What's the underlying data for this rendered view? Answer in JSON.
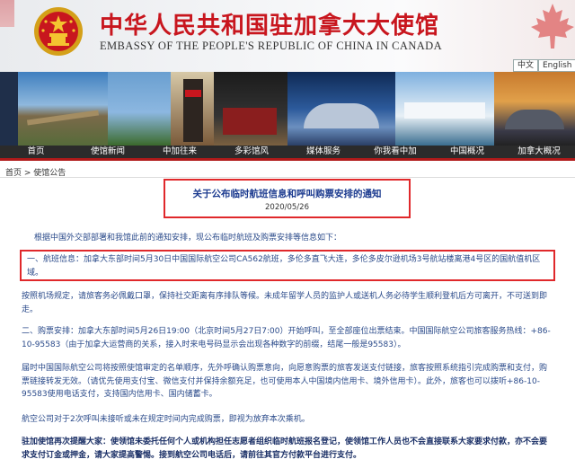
{
  "header": {
    "title_cn": "中华人民共和国驻加拿大大使馆",
    "title_en": "EMBASSY OF THE PEOPLE'S REPUBLIC OF CHINA IN CANADA",
    "lang_cn": "中文",
    "lang_en": "English"
  },
  "nav": {
    "items": [
      "首页",
      "使馆新闻",
      "中加往来",
      "多彩馆风",
      "媒体服务",
      "你我看中加",
      "中国概况",
      "加拿大概况"
    ]
  },
  "breadcrumb": "首页 > 使馆公告",
  "article": {
    "title": "关于公布临时航班信息和呼叫购票安排的通知",
    "date": "2020/05/26",
    "intro": "根据中国外交部部署和我馆此前的通知安排，现公布临时航班及购票安排等信息如下：",
    "p1": "一、航班信息：加拿大东部时间5月30日中国国际航空公司CA562航班，多伦多直飞大连，多伦多皮尔逊机场3号航站楼离港4号区的国航值机区域。",
    "p2": "按照机场规定，请旅客务必佩戴口罩，保持社交距离有序排队等候。未成年留学人员的监护人或送机人务必待学生顺利登机后方可离开，不可送到即走。",
    "p3": "二、购票安排：加拿大东部时间5月26日19:00（北京时间5月27日7:00）开始呼叫，至全部座位出票结束。中国国际航空公司旅客服务热线：+86-10-95583（由于加拿大运营商的关系，接入时来电号码显示会出现各种数字的前缀，结尾一般是95583）。",
    "p4": "届时中国国际航空公司将按照使馆审定的名单顺序，先外呼确认购票意向，向愿意购票的旅客发送支付链接，旅客按照系统指引完成购票和支付，购票链接转发无效。（请优先使用支付宝、微信支付并保持余额充足，也可使用本人中国境内信用卡、境外信用卡）。此外，旅客也可以拨听+86-10-95583使用电话支付，支持国内信用卡、国内储蓄卡。",
    "p5": "航空公司对于2次呼叫未接听或未在规定时间内完成购票，即视为放弃本次乘机。",
    "p6": "驻加使馆再次提醒大家：使领馆未委托任何个人或机构担任志愿者组织临时航班报名登记，使领馆工作人员也不会直接联系大家要求付款，亦不会要求支付订金或押金，请大家提高警惕。接到航空公司电话后，请前往其官方付款平台进行支付。"
  },
  "colors": {
    "brand_red": "#c8161e",
    "link_blue": "#2a4a8a",
    "nav_bg": "#2b2b2b"
  },
  "icons": [
    "national-emblem-icon",
    "maple-leaf-icon"
  ]
}
